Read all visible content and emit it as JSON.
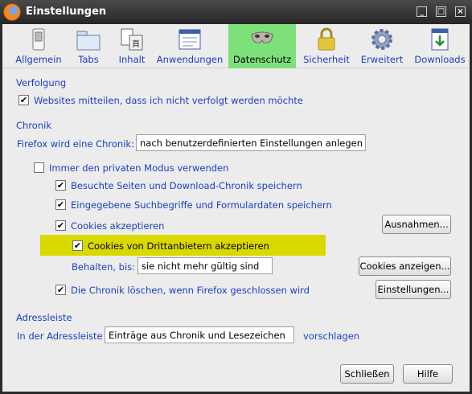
{
  "window": {
    "title": "Einstellungen"
  },
  "tabs": [
    {
      "label": "Allgemein",
      "icon": "switch-icon"
    },
    {
      "label": "Tabs",
      "icon": "tabs-icon"
    },
    {
      "label": "Inhalt",
      "icon": "content-icon"
    },
    {
      "label": "Anwendungen",
      "icon": "applications-icon"
    },
    {
      "label": "Datenschutz",
      "icon": "mask-icon",
      "active": true
    },
    {
      "label": "Sicherheit",
      "icon": "lock-icon"
    },
    {
      "label": "Erweitert",
      "icon": "gear-icon"
    },
    {
      "label": "Downloads",
      "icon": "download-icon"
    }
  ],
  "tracking": {
    "heading": "Verfolgung",
    "dnt_label": "Websites mitteilen, dass ich nicht verfolgt werden möchte",
    "dnt_checked": true
  },
  "history": {
    "heading": "Chronik",
    "firefox_will_label": "Firefox wird eine Chronik:",
    "mode_value": "nach benutzerdefinierten Einstellungen anlegen",
    "private_mode_label": "Immer den privaten Modus verwenden",
    "private_mode_checked": false,
    "visited_label": "Besuchte Seiten und Download-Chronik speichern",
    "visited_checked": true,
    "form_label": "Eingegebene Suchbegriffe und Formulardaten speichern",
    "form_checked": true,
    "cookies_label": "Cookies akzeptieren",
    "cookies_checked": true,
    "exceptions_button": "Ausnahmen...",
    "third_party_label": "Cookies von Drittanbietern akzeptieren",
    "third_party_checked": true,
    "keep_until_label": "Behalten, bis:",
    "keep_until_value": "sie nicht mehr gültig sind",
    "show_cookies_button": "Cookies anzeigen...",
    "clear_on_close_label": "Die Chronik löschen, wenn Firefox geschlossen wird",
    "clear_on_close_checked": true,
    "settings_button": "Einstellungen..."
  },
  "addressbar": {
    "heading": "Adressleiste",
    "prefix_label": "In der Adressleiste",
    "value": "Einträge aus Chronik und Lesezeichen",
    "suffix_label": "vorschlagen"
  },
  "footer": {
    "close_button": "Schließen",
    "help_button": "Hilfe"
  },
  "colors": {
    "label_blue": "#1a3ec2",
    "active_tab_green": "#7ee07a",
    "highlight_yellow": "#d9d900"
  }
}
